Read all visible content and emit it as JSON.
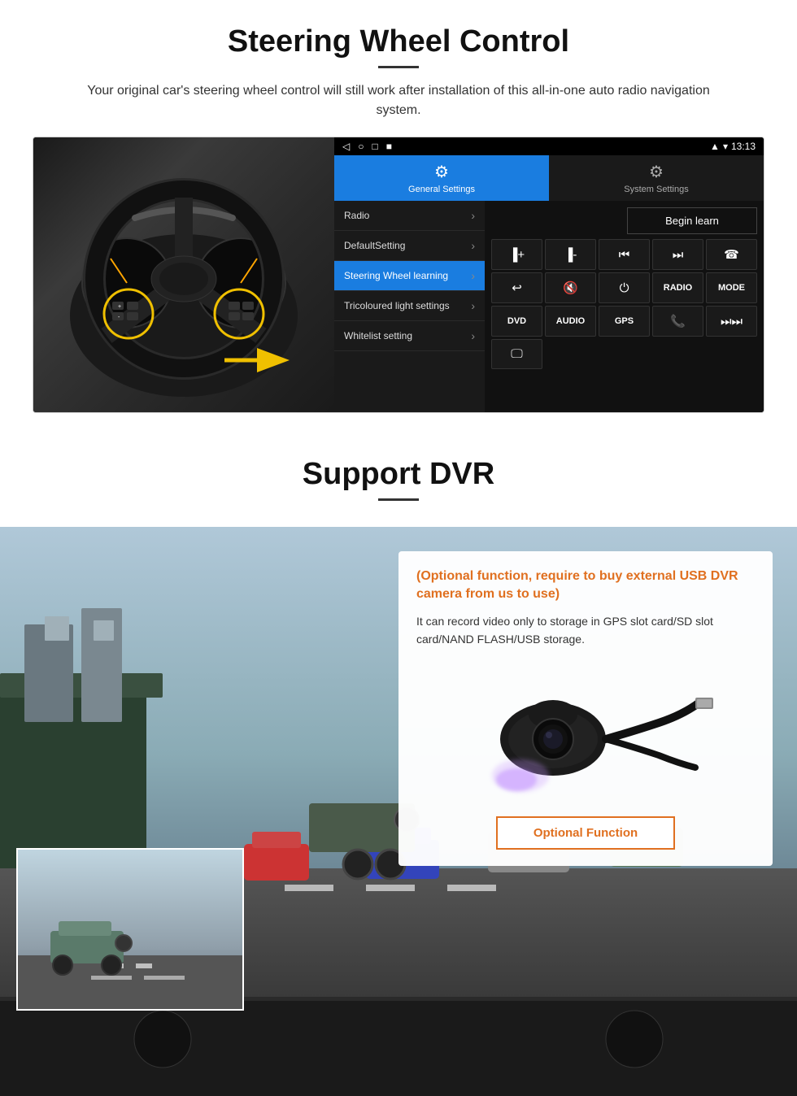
{
  "steering_section": {
    "title": "Steering Wheel Control",
    "description": "Your original car's steering wheel control will still work after installation of this all-in-one auto radio navigation system.",
    "status_bar": {
      "time": "13:13",
      "signal_icon": "▲",
      "wifi_icon": "▾",
      "battery_icon": "▮"
    },
    "nav_items": [
      "◁",
      "○",
      "□",
      "■"
    ],
    "tabs": [
      {
        "label": "General Settings",
        "active": true,
        "icon": "⚙"
      },
      {
        "label": "System Settings",
        "active": false,
        "icon": "⚙"
      }
    ],
    "menu_items": [
      {
        "label": "Radio",
        "active": false
      },
      {
        "label": "DefaultSetting",
        "active": false
      },
      {
        "label": "Steering Wheel learning",
        "active": true
      },
      {
        "label": "Tricoloured light settings",
        "active": false
      },
      {
        "label": "Whitelist setting",
        "active": false
      }
    ],
    "begin_learn_label": "Begin learn",
    "control_buttons": [
      "⏮+",
      "⏮-",
      "⏮⏮",
      "⏭⏭",
      "☎",
      "↩",
      "🔇×",
      "⏻",
      "RADIO",
      "MODE",
      "DVD",
      "AUDIO",
      "GPS",
      "☎⏮",
      "⏭⏭"
    ],
    "control_buttons_display": [
      {
        "label": "▐+",
        "type": "icon"
      },
      {
        "label": "▐-",
        "type": "icon"
      },
      {
        "label": "⏮",
        "type": "icon"
      },
      {
        "label": "⏭",
        "type": "icon"
      },
      {
        "label": "☎",
        "type": "icon"
      },
      {
        "label": "↩",
        "type": "icon"
      },
      {
        "label": "🔇",
        "type": "icon"
      },
      {
        "label": "⏻",
        "type": "icon"
      },
      {
        "label": "RADIO",
        "type": "text"
      },
      {
        "label": "MODE",
        "type": "text"
      },
      {
        "label": "DVD",
        "type": "text"
      },
      {
        "label": "AUDIO",
        "type": "text"
      },
      {
        "label": "GPS",
        "type": "text"
      },
      {
        "label": "📞⏮",
        "type": "icon"
      },
      {
        "label": "⏭⏭",
        "type": "icon"
      }
    ]
  },
  "dvr_section": {
    "title": "Support DVR",
    "optional_title": "(Optional function, require to buy external USB DVR camera from us to use)",
    "description": "It can record video only to storage in GPS slot card/SD slot card/NAND FLASH/USB storage.",
    "optional_function_label": "Optional Function"
  }
}
